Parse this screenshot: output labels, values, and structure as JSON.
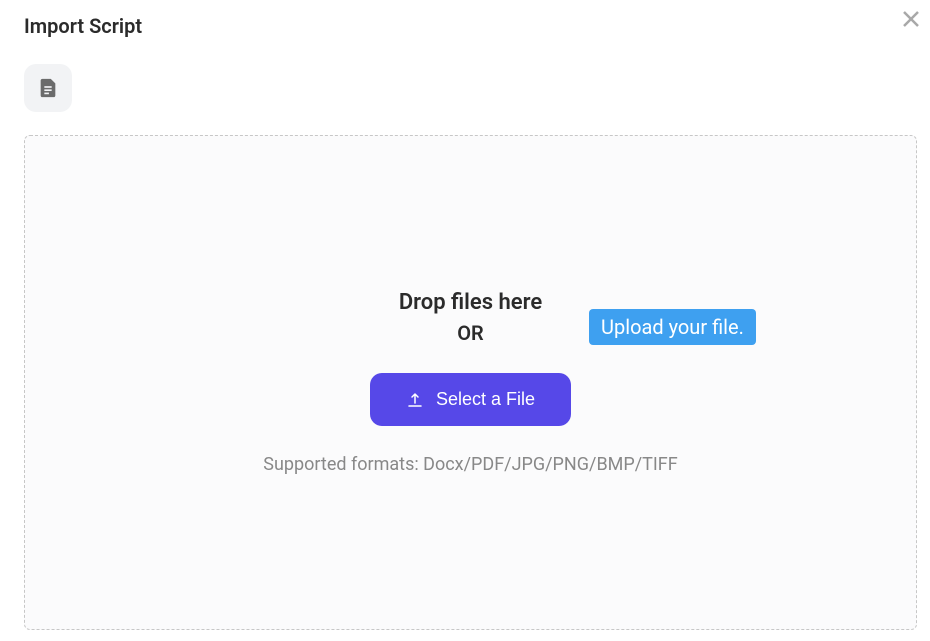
{
  "header": {
    "title": "Import Script"
  },
  "dropzone": {
    "drop_text": "Drop files here",
    "or_text": "OR",
    "select_button_label": "Select a File",
    "supported_formats": "Supported formats: Docx/PDF/JPG/PNG/BMP/TIFF"
  },
  "tooltip": {
    "text": "Upload your file."
  }
}
